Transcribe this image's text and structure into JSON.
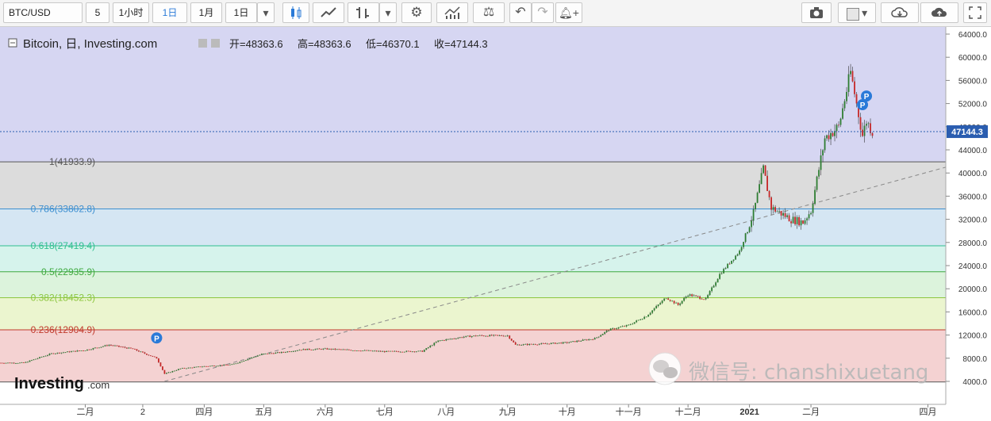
{
  "toolbar": {
    "symbol": "BTC/USD",
    "resolution_value": "5",
    "btn_1h": "1小时",
    "btn_1d": "1日",
    "btn_1m": "1月",
    "btn_period": "1日"
  },
  "legend": {
    "title": "Bitcoin, 日, Investing.com",
    "open": "开=48363.6",
    "high": "高=48363.6",
    "low": "低=46370.1",
    "close": "收=47144.3"
  },
  "chart_data": {
    "type": "candlestick",
    "title": "Bitcoin, 日, Investing.com",
    "ylim": [
      0,
      65000
    ],
    "y_ticks": [
      "64000.0",
      "60000.0",
      "56000.0",
      "52000.0",
      "48000.0",
      "44000.0",
      "40000.0",
      "36000.0",
      "32000.0",
      "28000.0",
      "24000.0",
      "20000.0",
      "16000.0",
      "12000.0",
      "8000.0",
      "4000.0"
    ],
    "y_values": [
      64000,
      60000,
      56000,
      52000,
      48000,
      44000,
      40000,
      36000,
      32000,
      28000,
      24000,
      20000,
      16000,
      12000,
      8000,
      4000
    ],
    "x_tick_labels": [
      "二月",
      "2",
      "四月",
      "五月",
      "六月",
      "七月",
      "八月",
      "九月",
      "十月",
      "十一月",
      "十二月",
      "2021",
      "二月",
      "四月"
    ],
    "x_tick_dates": [
      "2020-02-01",
      "2020-03-01",
      "2020-04-01",
      "2020-05-01",
      "2020-06-01",
      "2020-07-01",
      "2020-08-01",
      "2020-09-01",
      "2020-10-01",
      "2020-11-01",
      "2020-12-01",
      "2021-01-01",
      "2021-02-01",
      "2021-04-01"
    ],
    "x_range": [
      "2019-12-20",
      "2021-04-10"
    ],
    "last_price": "47144.3",
    "fib_levels": [
      {
        "label": "1(41933.9)",
        "ratio": 1,
        "price": 41933.9,
        "fill": "#dcdcdc",
        "line": "#555555",
        "text": "#555555"
      },
      {
        "label": "0.786(33802.8)",
        "ratio": 0.786,
        "price": 33802.8,
        "fill": "#d5e6f3",
        "line": "#3d8fd0",
        "text": "#3d8fd0"
      },
      {
        "label": "0.618(27419.4)",
        "ratio": 0.618,
        "price": 27419.4,
        "fill": "#d6f3ec",
        "line": "#2fbf8f",
        "text": "#2fbf8f"
      },
      {
        "label": "0.5(22935.9)",
        "ratio": 0.5,
        "price": 22935.9,
        "fill": "#dcf3dc",
        "line": "#3faa3f",
        "text": "#3faa3f"
      },
      {
        "label": "0.382(18452.3)",
        "ratio": 0.382,
        "price": 18452.3,
        "fill": "#ebf5cf",
        "line": "#8cc63f",
        "text": "#8cc63f"
      },
      {
        "label": "0.236(12904.9)",
        "ratio": 0.236,
        "price": 12904.9,
        "fill": "#f4d2d2",
        "line": "#c0392b",
        "text": "#c0392b"
      }
    ],
    "fib_zero_price": 3900,
    "fib_top_fill": "#d6d6f2",
    "trendline": {
      "start": [
        "2020-03-12",
        4000
      ],
      "end": [
        "2021-04-10",
        41000
      ]
    },
    "path_points": [
      [
        "2019-12-20",
        7200
      ],
      [
        "2020-01-01",
        7200
      ],
      [
        "2020-01-15",
        8800
      ],
      [
        "2020-02-01",
        9400
      ],
      [
        "2020-02-13",
        10300
      ],
      [
        "2020-02-25",
        9600
      ],
      [
        "2020-03-08",
        8000
      ],
      [
        "2020-03-12",
        5300
      ],
      [
        "2020-03-20",
        6200
      ],
      [
        "2020-04-01",
        6600
      ],
      [
        "2020-04-15",
        6900
      ],
      [
        "2020-04-30",
        8700
      ],
      [
        "2020-05-10",
        9000
      ],
      [
        "2020-05-20",
        9500
      ],
      [
        "2020-06-01",
        9600
      ],
      [
        "2020-06-15",
        9400
      ],
      [
        "2020-07-01",
        9150
      ],
      [
        "2020-07-20",
        9200
      ],
      [
        "2020-07-28",
        11000
      ],
      [
        "2020-08-10",
        11700
      ],
      [
        "2020-08-17",
        11900
      ],
      [
        "2020-09-01",
        11900
      ],
      [
        "2020-09-05",
        10300
      ],
      [
        "2020-09-20",
        10500
      ],
      [
        "2020-10-01",
        10700
      ],
      [
        "2020-10-15",
        11400
      ],
      [
        "2020-10-22",
        12900
      ],
      [
        "2020-11-01",
        13700
      ],
      [
        "2020-11-10",
        15300
      ],
      [
        "2020-11-20",
        18500
      ],
      [
        "2020-11-26",
        17200
      ],
      [
        "2020-12-01",
        19000
      ],
      [
        "2020-12-10",
        18200
      ],
      [
        "2020-12-17",
        22500
      ],
      [
        "2020-12-27",
        26500
      ],
      [
        "2021-01-03",
        33000
      ],
      [
        "2021-01-08",
        40700
      ],
      [
        "2021-01-12",
        34000
      ],
      [
        "2021-01-22",
        32000
      ],
      [
        "2021-01-28",
        31500
      ],
      [
        "2021-02-01",
        33500
      ],
      [
        "2021-02-08",
        46000
      ],
      [
        "2021-02-15",
        48000
      ],
      [
        "2021-02-21",
        57400
      ],
      [
        "2021-02-27",
        46500
      ],
      [
        "2021-03-01",
        49000
      ],
      [
        "2021-03-04",
        47144
      ]
    ],
    "p_markers": [
      [
        "2020-03-08",
        11500
      ],
      [
        "2021-02-27",
        51800
      ],
      [
        "2021-03-01",
        53300
      ]
    ]
  },
  "watermark": {
    "brand": "Investing",
    "brand_suffix": ".com",
    "wechat": "微信号: chanshixuetang"
  },
  "colors": {
    "up": "#2e7d32",
    "down": "#c62828",
    "price_line": "#2a5db0",
    "accent": "#2a7ad8"
  }
}
